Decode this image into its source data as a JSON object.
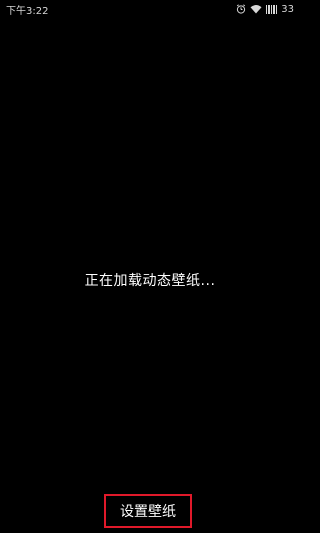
{
  "status_bar": {
    "time": "下午3:22",
    "battery": "33",
    "icons": [
      "alarm-icon",
      "wifi-icon",
      "signal-icon"
    ]
  },
  "main": {
    "loading_text": "正在加载动态壁纸..."
  },
  "actions": {
    "set_wallpaper_label": "设置壁纸"
  },
  "colors": {
    "background": "#000000",
    "text": "#ffffff",
    "highlight_border": "#e0192a"
  }
}
